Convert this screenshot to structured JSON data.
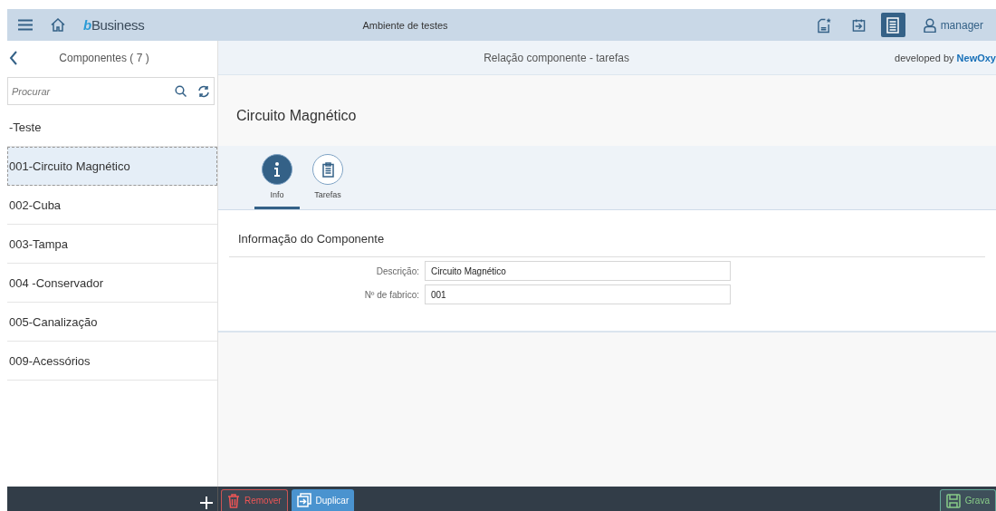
{
  "header": {
    "brand_prefix": "b",
    "brand": "Business",
    "environment": "Ambiente de testes",
    "user": "manager",
    "actions": [
      {
        "kind": "favorite-doc",
        "selected": false
      },
      {
        "kind": "calendar-arrow",
        "selected": false
      },
      {
        "kind": "list-doc",
        "selected": true
      }
    ]
  },
  "sidebar": {
    "title": "Componentes ( 7 )",
    "search": {
      "placeholder": "Procurar"
    },
    "items": [
      {
        "label": "-Teste",
        "selected": false
      },
      {
        "label": "001-Circuito Magnético",
        "selected": true
      },
      {
        "label": "002-Cuba",
        "selected": false
      },
      {
        "label": "003-Tampa",
        "selected": false
      },
      {
        "label": "004 -Conservador",
        "selected": false
      },
      {
        "label": "005-Canalização",
        "selected": false
      },
      {
        "label": "009-Acessórios",
        "selected": false
      }
    ]
  },
  "page": {
    "title": "Relação componente - tarefas",
    "credit": "developed by",
    "credit_brand": "NewOxy",
    "object_title": "Circuito Magnético",
    "tabs": [
      {
        "label": "Info",
        "kind": "info",
        "selected": true
      },
      {
        "label": "Tarefas",
        "kind": "clipboard",
        "selected": false
      }
    ],
    "section": "Informação do Componente",
    "fields": [
      {
        "label": "Descrição:",
        "value": "Circuito Magnético"
      },
      {
        "label": "Nº de fabrico:",
        "value": "001"
      }
    ]
  },
  "footer": {
    "left_buttons": [
      {
        "kind": "add"
      }
    ],
    "buttons": [
      {
        "kind": "delete",
        "label": "Remover"
      },
      {
        "kind": "duplicate",
        "label": "Duplicar"
      },
      {
        "kind": "save",
        "label": "Grava"
      }
    ]
  }
}
